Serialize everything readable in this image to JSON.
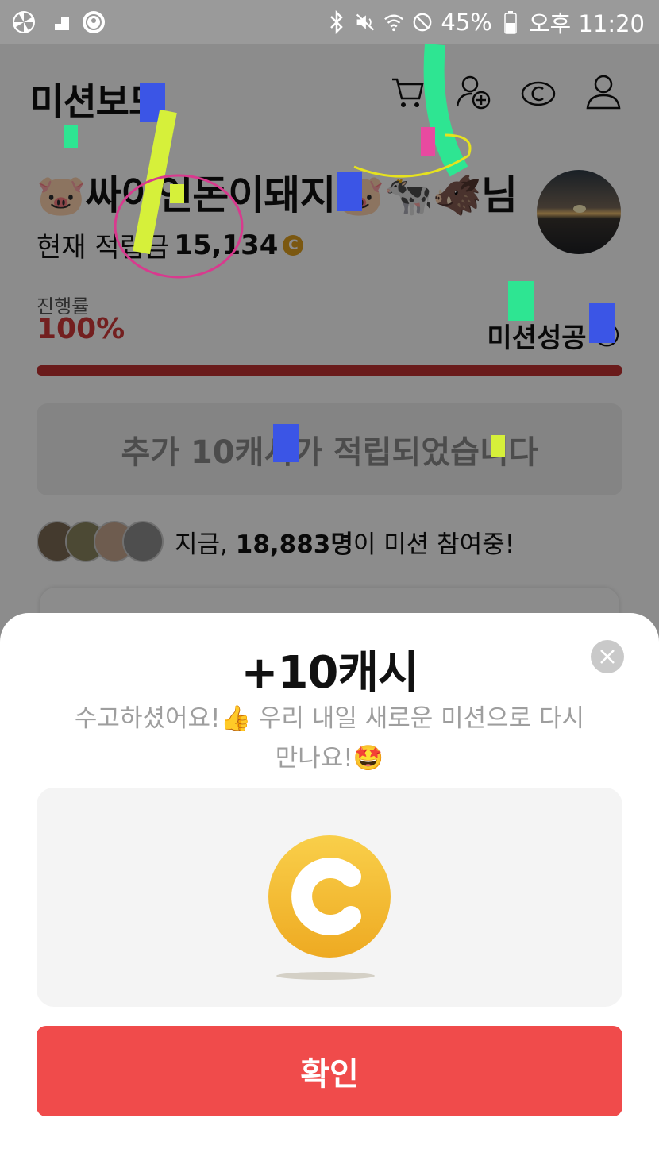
{
  "status_bar": {
    "battery": "45%",
    "time": "오후 11:20",
    "left_icons": [
      "pinwheel-icon",
      "stairs-icon",
      "starbucks-icon"
    ],
    "right_icons": [
      "bluetooth-icon",
      "mute-icon",
      "wifi-icon",
      "do-not-disturb-icon",
      "battery-icon"
    ]
  },
  "app_bar": {
    "title": "미션보드",
    "icons": [
      "cart-icon",
      "add-friend-icon",
      "cash-icon",
      "profile-icon"
    ]
  },
  "mission": {
    "name_emoji": "🐷",
    "name": "싸이언돈이돼지",
    "animals": "🐷🐄🐗",
    "suffix": "님",
    "savings_label": "현재 적립금",
    "savings_amount": "15,134",
    "coin_glyph": "C",
    "progress_label": "진행률",
    "progress_value": "100%",
    "progress_fraction": 1.0,
    "status": "미션성공",
    "status_emoji": "😝"
  },
  "bonus_banner": "추가 10캐시가 적립되었습니다",
  "participants": {
    "prefix": "지금, ",
    "count": "18,883명",
    "suffix": "이 미션 참여중!"
  },
  "sheet": {
    "title": "+10캐시",
    "message_line1": "수고하셨어요!👍 우리 내일 새로운 미션으로 다시",
    "message_line2": "만나요!🤩",
    "confirm_label": "확인"
  },
  "colors": {
    "accent_red": "#f04b4b",
    "progress_red": "#c23232",
    "coin_gold": "#f3b52c"
  }
}
